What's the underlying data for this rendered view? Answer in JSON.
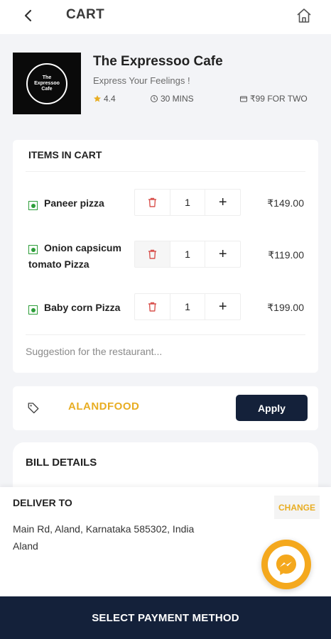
{
  "header": {
    "title": "CART",
    "back_icon": "chevron-left-icon",
    "home_icon": "home-icon"
  },
  "restaurant": {
    "name": "The Expressoo Cafe",
    "tagline": "Express Your Feelings !",
    "rating": "4.4",
    "delivery_time": "30 MINS",
    "price_for_two": "₹99 FOR TWO",
    "logo_text": [
      "The",
      "Expressoo",
      "Cafe"
    ]
  },
  "cart": {
    "title": "ITEMS IN CART",
    "items": [
      {
        "name": "Paneer pizza",
        "qty": "1",
        "price": "₹149.00"
      },
      {
        "name": "Onion capsicum tomato Pizza",
        "qty": "1",
        "price": "₹119.00"
      },
      {
        "name": "Baby corn Pizza",
        "qty": "1",
        "price": "₹199.00"
      }
    ],
    "suggestion_placeholder": "Suggestion for the restaurant..."
  },
  "coupon": {
    "code": "ALANDFOOD",
    "apply_label": "Apply"
  },
  "bill": {
    "title": "BILL DETAILS"
  },
  "delivery": {
    "title": "DELIVER TO",
    "change_label": "CHANGE",
    "address_line1": "Main Rd, Aland, Karnataka 585302, India",
    "address_line2": "Aland"
  },
  "footer": {
    "pay_label": "SELECT PAYMENT METHOD"
  },
  "colors": {
    "accent": "#e8ad22",
    "primary_dark": "#14213a",
    "veg_green": "#2e9e3a",
    "delete_red": "#d9534f",
    "fab_orange": "#f4a81d"
  }
}
